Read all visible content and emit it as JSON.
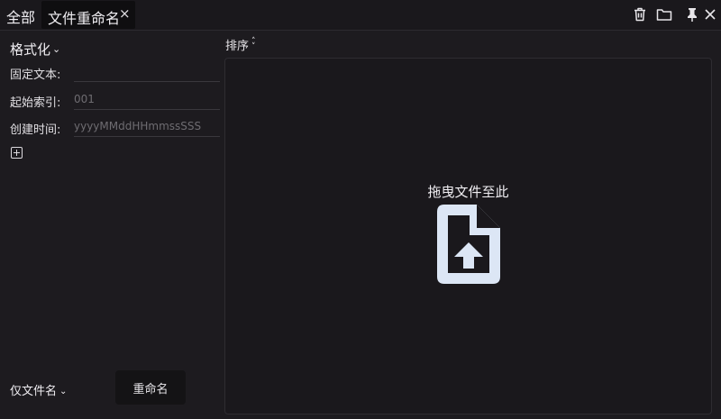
{
  "tabs": {
    "all_label": "全部",
    "active_label": "文件重命名",
    "close_glyph": "×"
  },
  "toolbar": {
    "icons": [
      "trash-icon",
      "folder-icon",
      "pin-icon",
      "close-icon"
    ]
  },
  "format": {
    "header": "格式化",
    "fields": [
      {
        "label": "固定文本:",
        "value": "",
        "placeholder": ""
      },
      {
        "label": "起始索引:",
        "value": "",
        "placeholder": "001"
      },
      {
        "label": "创建时间:",
        "value": "",
        "placeholder": "yyyyMMddHHmmssSSS"
      }
    ]
  },
  "mode": {
    "selected": "仅文件名"
  },
  "rename_button": "重命名",
  "sort_label": "排序",
  "dropzone": {
    "text": "拖曳文件至此"
  },
  "colors": {
    "background": "#1d1b1f",
    "icon": "#dce6f5",
    "text": "#f0eef2"
  }
}
